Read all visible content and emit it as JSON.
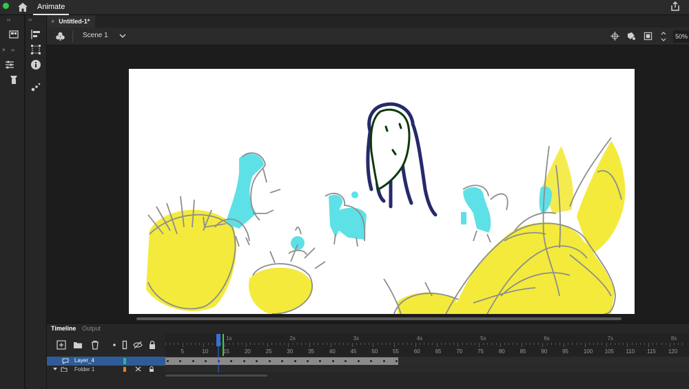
{
  "app": {
    "title": "Animate"
  },
  "document_tab": {
    "label": "Untitled-1*",
    "close": "×"
  },
  "scene": {
    "label": "Scene 1",
    "zoom": "50%"
  },
  "timeline": {
    "tabs": [
      "Timeline",
      "Output"
    ],
    "seconds": [
      "1s",
      "2s",
      "3s",
      "4s",
      "5s",
      "6s",
      "7s",
      "8s"
    ],
    "frame_numbers": [
      "5",
      "10",
      "15",
      "20",
      "25",
      "30",
      "35",
      "40",
      "45",
      "50",
      "55",
      "60",
      "65",
      "70",
      "75",
      "80",
      "85",
      "90",
      "95",
      "100",
      "105",
      "110",
      "115",
      "120"
    ],
    "layers": [
      {
        "name": "Layer_4",
        "color": "#2bb59a",
        "selected": true
      },
      {
        "name": "Folder 1",
        "color": "#f07c1e",
        "selected": false
      }
    ],
    "current_frame": 13,
    "last_frame": 55
  },
  "colors": {
    "accent": "#2f5c98",
    "playhead": "#3a6fd8",
    "green_marker": "#33d64a"
  },
  "icons": {
    "top": [
      "home-icon",
      "share-icon"
    ],
    "left_panel_1": [
      "library-icon",
      "properties-icon",
      "brush-library-icon"
    ],
    "left_panel_2": [
      "align-icon",
      "transform-icon",
      "info-icon",
      "motion-presets-icon"
    ],
    "scene_bar": [
      "edit-symbols-icon",
      "chevron-down-icon",
      "center-stage-icon",
      "clip-icon",
      "fit-stage-icon",
      "zoom-stepper-icon"
    ],
    "timeline_controls": [
      "new-layer-icon",
      "new-folder-icon",
      "delete-layer-icon",
      "dot-icon",
      "outline-icon",
      "visibility-icon",
      "lock-icon"
    ]
  }
}
